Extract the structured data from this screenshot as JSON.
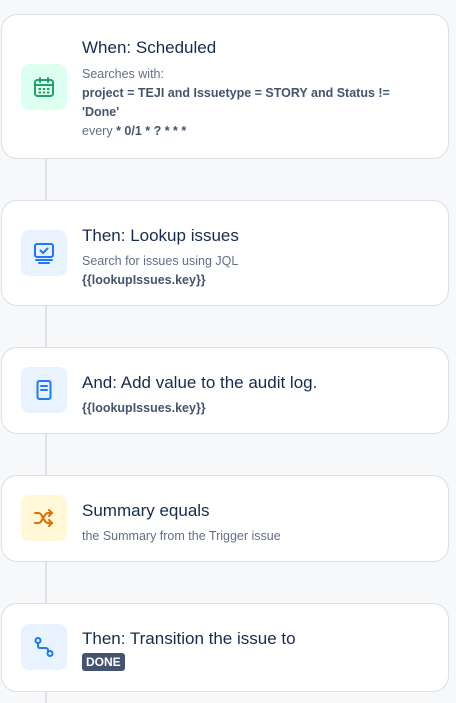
{
  "steps": [
    {
      "title": "When: Scheduled",
      "icon": "calendar-icon",
      "searches_label": "Searches with:",
      "jql_line1": "project = TEJI and Issuetype = STORY and Status !=",
      "jql_line2": "'Done'",
      "every_label": "every",
      "schedule": "* 0/1 * ? * * *"
    },
    {
      "title": "Then: Lookup issues",
      "icon": "monitor-icon",
      "description": "Search for issues using JQL",
      "smart_value": "{{lookupIssues.key}}"
    },
    {
      "title": "And: Add value to the audit log.",
      "icon": "document-icon",
      "smart_value": "{{lookupIssues.key}}"
    },
    {
      "title": "Summary equals",
      "icon": "shuffle-icon",
      "description": "the Summary from the Trigger issue"
    },
    {
      "title": "Then: Transition the issue to",
      "icon": "path-icon",
      "status": "DONE"
    }
  ],
  "colors": {
    "trigger_tile": "#dcfff1",
    "trigger_icon": "#22a06b",
    "action_tile": "#e9f2ff",
    "action_icon": "#1d7afc",
    "condition_tile": "#fff7d6",
    "condition_icon": "#d97008",
    "lozenge": "#44546f"
  }
}
